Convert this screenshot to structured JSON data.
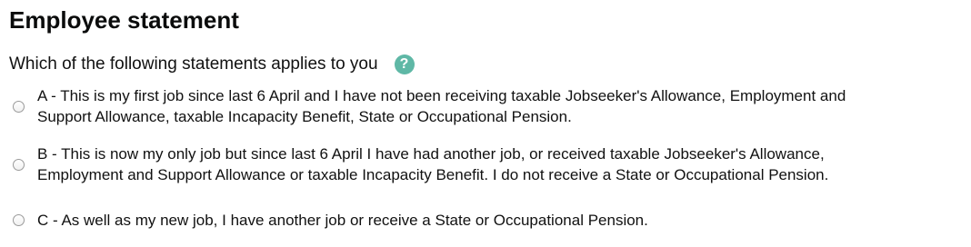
{
  "form": {
    "heading": "Employee statement",
    "question": "Which of the following statements applies to you",
    "help_icon": "question-mark-icon",
    "help_glyph": "?",
    "colors": {
      "help_icon_bg": "#5fb8a6",
      "text": "#111111"
    },
    "options": [
      {
        "line1": "A - This is my first job since last 6 April and I have not been receiving taxable Jobseeker's Allowance, Employment and",
        "line2": "Support Allowance, taxable Incapacity Benefit, State or Occupational Pension.",
        "selected": false
      },
      {
        "line1": "B - This is now my only job but since last 6 April I have had another job, or received taxable Jobseeker's Allowance,",
        "line2": "Employment and Support Allowance or taxable Incapacity Benefit. I do not receive a State or Occupational Pension.",
        "selected": false
      },
      {
        "line1": "C - As well as my new job, I have another job or receive a State or Occupational Pension.",
        "selected": false
      }
    ]
  }
}
